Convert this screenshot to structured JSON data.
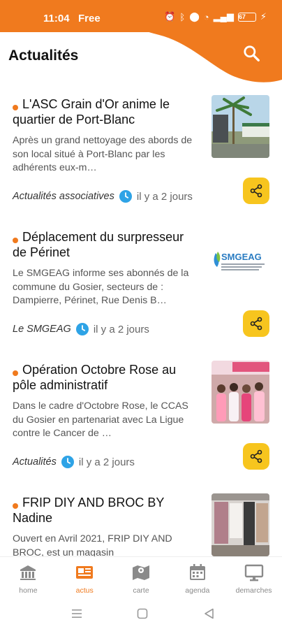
{
  "status_bar": {
    "time": "11:04",
    "carrier": "Free",
    "battery": "67"
  },
  "header": {
    "title": "Actualités"
  },
  "colors": {
    "accent": "#f07a1e",
    "share": "#f7c51e",
    "clock": "#2ea3e6"
  },
  "articles": [
    {
      "title": "L'ASC Grain d'Or anime le quartier de Port-Blanc",
      "excerpt": "Après un grand nettoyage des abords de son local situé à Port-Blanc par les adhérents eux-m…",
      "source": "Actualités associatives",
      "time": "il y a 2 jours",
      "thumb": "photo-palm-tree"
    },
    {
      "title": "Déplacement du surpresseur de Périnet",
      "excerpt": "Le SMGEAG informe ses abonnés de la commune du Gosier, secteurs de : Dampierre, Périnet, Rue Denis B…",
      "source": "Le SMGEAG",
      "time": "il y a 2 jours",
      "thumb": "smgeag-logo",
      "logo_text": "SMGEAG"
    },
    {
      "title": "Opération Octobre Rose au pôle administratif",
      "excerpt": "Dans le cadre d'Octobre Rose, le CCAS du Gosier en partenariat avec La Ligue contre le Cancer de …",
      "source": "Actualités",
      "time": "il y a 2 jours",
      "thumb": "photo-group-pink"
    },
    {
      "title": "FRIP DIY AND BROC BY Nadine",
      "excerpt": "Ouvert en Avril 2021, FRIP DIY AND BROC, est un magasin",
      "source": "",
      "time": "",
      "thumb": "photo-clothes-shop"
    }
  ],
  "bottom_nav": [
    {
      "label": "home",
      "icon": "bank-icon",
      "active": false
    },
    {
      "label": "actus",
      "icon": "news-icon",
      "active": true
    },
    {
      "label": "carte",
      "icon": "map-icon",
      "active": false
    },
    {
      "label": "agenda",
      "icon": "calendar-icon",
      "active": false
    },
    {
      "label": "demarches",
      "icon": "monitor-icon",
      "active": false
    }
  ]
}
